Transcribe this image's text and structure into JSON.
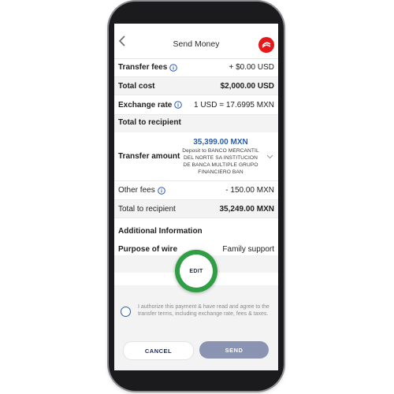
{
  "header": {
    "title": "Send Money",
    "back_icon": "chevron-left-icon",
    "logo_icon": "brand-logo-icon",
    "logo_color": "#e3191b"
  },
  "summary": {
    "transfer_fees_label": "Transfer fees",
    "transfer_fees_value": "+ $0.00 USD",
    "total_cost_label": "Total cost",
    "total_cost_value": "$2,000.00 USD",
    "exchange_rate_label": "Exchange rate",
    "exchange_rate_value": "1 USD = 17.6995 MXN"
  },
  "recipient": {
    "section_title": "Total to recipient",
    "transfer_amount_label": "Transfer amount",
    "transfer_amount_value": "35,399.00 MXN",
    "transfer_amount_detail": "Deposit to BANCO MERCANTIL DEL NORTE SA INSTITUCION DE BANCA MULTIPLE GRUPO FINANCIERO BAN",
    "other_fees_label": "Other fees",
    "other_fees_value": "- 150.00 MXN",
    "total_label": "Total to recipient",
    "total_value": "35,249.00 MXN"
  },
  "additional": {
    "section_title": "Additional Information",
    "purpose_label": "Purpose of wire",
    "purpose_value": "Family support",
    "edit_label": "EDIT"
  },
  "consent": {
    "text": "I authorize this payment & have read and agree to the transfer terms, including exchange rate, fees & taxes."
  },
  "actions": {
    "cancel_label": "CANCEL",
    "send_label": "SEND"
  },
  "colors": {
    "accent_blue": "#2a5db0",
    "highlight_green": "#2f9e44",
    "send_disabled": "#8a93b2"
  }
}
